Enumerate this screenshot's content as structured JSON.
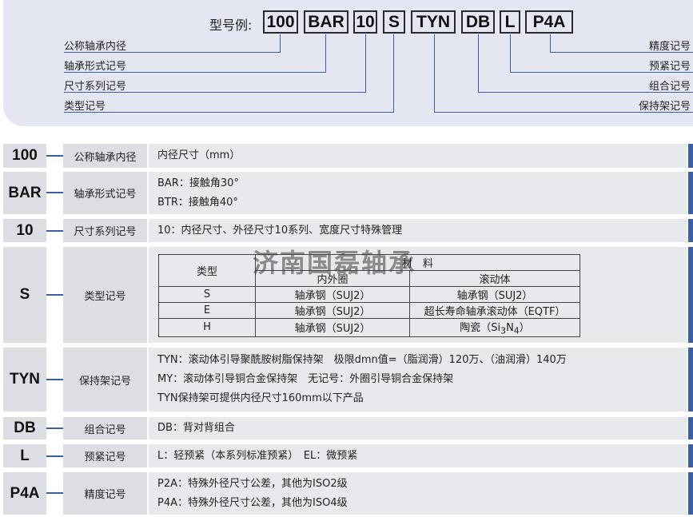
{
  "header": {
    "model_label": "型号例:",
    "codes": [
      "100",
      "BAR",
      "10",
      "S",
      "TYN",
      "DB",
      "L",
      "P4A"
    ],
    "left_labels": [
      "公称轴承内径",
      "轴承形式记号",
      "尺寸系列记号",
      "类型记号"
    ],
    "right_labels": [
      "精度记号",
      "预紧记号",
      "组合记号",
      "保持架记号"
    ]
  },
  "rows": [
    {
      "code": "100",
      "name": "公称轴承内径",
      "lines": [
        "内径尺寸（mm）"
      ]
    },
    {
      "code": "BAR",
      "name": "轴承形式记号",
      "lines": [
        "BAR：接触角30°",
        "BTR：接触角40°"
      ]
    },
    {
      "code": "10",
      "name": "尺寸系列记号",
      "lines": [
        "10：内径尺寸、外径尺寸10系列、宽度尺寸特殊管理"
      ]
    },
    {
      "code": "S",
      "name": "类型记号"
    },
    {
      "code": "TYN",
      "name": "保持架记号",
      "lines": [
        "TYN：滚动体引导聚酰胺树脂保持架　极限dmn值=（脂润滑）120万、（油润滑）140万",
        "MY：滚动体引导铜合金保持架　无记号：外圈引导铜合金保持架",
        "TYN保持架可提供内径尺寸160mm以下产品"
      ]
    },
    {
      "code": "DB",
      "name": "组合记号",
      "lines": [
        "DB：背对背组合"
      ]
    },
    {
      "code": "L",
      "name": "预紧记号",
      "lines": [
        "L：轻预紧（本系列标准预紧）　EL：微预紧"
      ]
    },
    {
      "code": "P4A",
      "name": "精度记号",
      "lines": [
        "P2A：特殊外径尺寸公差，其他为ISO2级",
        "P4A：特殊外径尺寸公差，其他为ISO4级"
      ]
    }
  ],
  "material_table": {
    "type_header": "类型",
    "material_header": "材　料",
    "col_inner": "内外圈",
    "col_rolling": "滚动体",
    "rows": [
      {
        "type": "S",
        "inner": "轴承钢（SUJ2）",
        "rolling": "轴承钢（SUJ2）"
      },
      {
        "type": "E",
        "inner": "轴承钢（SUJ2）",
        "rolling": "超长寿命轴承滚动体（EQTF）"
      },
      {
        "type": "H",
        "inner": "轴承钢（SUJ2）",
        "rolling_prefix": "陶瓷（Si",
        "rolling_sub1": "3",
        "rolling_mid": "N",
        "rolling_sub2": "4",
        "rolling_suffix": "）"
      }
    ]
  },
  "watermark": "济南国磊轴承",
  "colors": {
    "accent": "#3a5fa6",
    "panel": "#e4e7f1",
    "cell": "#dcdee4",
    "desc": "#e8e9ed"
  }
}
